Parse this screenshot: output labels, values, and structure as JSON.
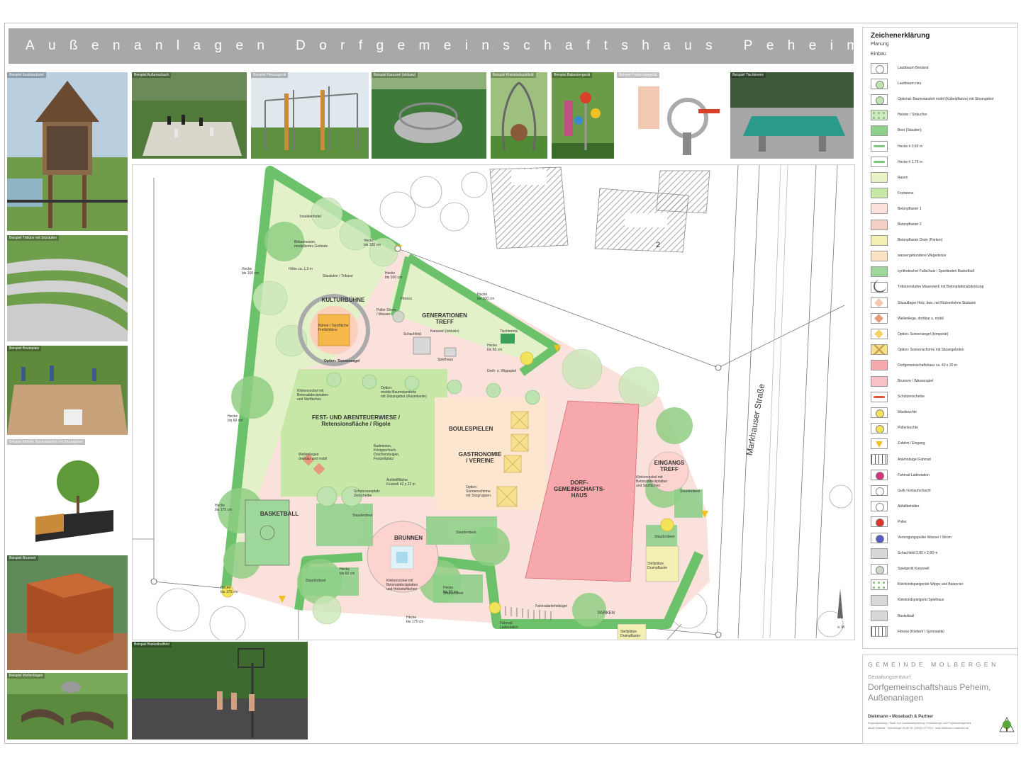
{
  "title": "Außenanlagen Dorfgemeinschaftshaus Peheim",
  "photos": {
    "insektenhotel": "Beispiel Insektenhotel",
    "aussenschach": "Beispiel Außenschach",
    "fitness": "Beispiel Fitnessgerät",
    "karussel": "Beispiel Karussel (inklusiv)",
    "kleinkind": "Beispiel Kleinkindspielfeld",
    "balancier": "Beispiel Balanciergerät",
    "federwipp": "Beispiel Federwippgerät",
    "tischtennis": "Beispiel Tischtennis",
    "tribuene": "Beispiel Tribüne mit Sitzstufen",
    "boule": "Beispiel Bouleplatz",
    "baumstandort": "Beispiel Mobiler Baumstandort mit Sitzangebot",
    "brunnen": "Beispiel Brunnen",
    "wellenliege": "Beispiel Wellenliegen",
    "basketball": "Beispiel Basketballfeld"
  },
  "plan": {
    "building_no": "2",
    "street": "Markhauser Straße",
    "areas": {
      "kulturbuehne": "KULTURBÜHNE",
      "generationen": "GENERATIONEN\nTREFF",
      "festwiese": "FEST- UND ABENTEUERWIESE /\nRetensionsfläche / Rigole",
      "boule": "BOULESPIELEN",
      "gastro": "GASTRONOMIE\n/ VEREINE",
      "dgh": "DORF-\nGEMEINSCHAFTS-\nHAUS",
      "eingang": "EINGANGS\nTREFF",
      "basketball": "BASKETBALL",
      "brunnen": "BRUNNEN",
      "parken": "PARKEN"
    },
    "labels": {
      "insektenhotel": "Insektenhotel",
      "birken": "Birkenheister,\nmodelliertes Gelände",
      "hoehe": "Höhe ca. 1,0 m",
      "sitzstufen": "Sitzstufen / Tribüne",
      "buehne": "Bühne / Tanzfläche\nFreilichtkino",
      "sonnensegel": "Option: Sonnensegel",
      "poller": "Poller Strom\n/ Wasser",
      "fitness": "Fitness",
      "karussel": "Karussel (inklusiv)",
      "schachfeld": "Schachfeld",
      "spielhaus": "Spielhaus",
      "tischtennis": "Tischtennis",
      "dreh": "Dreh- u. Wippspiel",
      "klinker1": "Klinkersockel mit\nBetonabdeckplatten\nund Sitzflächen",
      "mobile": "Option:\nmobile Baumstandorte\nmit Sitzangebot (Raumkante)",
      "wellen": "Wellenliegen\ndrehbar und mobil",
      "badminton": "Badminton,\nKönigsschach,\nDrachensteigen,\nFestzeltplatz",
      "festzelt": "Aufstellfläche\nFestzelt 42 x 22 m",
      "schirme": "Option:\nSonnenschirme\nmit Sitzgruppen",
      "schutz": "Schutzzaunplatz\nZielscheibe",
      "staudenbeet": "Staudenbeet",
      "klinker2": "Klinkersockel mit\nBetonabdeckplatten\nund Holzsitzflächen",
      "klinker3": "Klinkersockel mit\nBetonabdeckplatten\nund Sitzflächen",
      "fahrrad": "Fahrradanlehnbügel",
      "ladestation": "Fahrrad\nLadestation",
      "stellplaetze": "Stellplätze\nDrainpflaster",
      "hecke100": "Hecke\nbis 100 cm",
      "hecke60": "Hecke\nbis 60 cm",
      "hecke175": "Hecke\nbis 175 cm"
    },
    "north": "o. M"
  },
  "legend": {
    "title": "Zeichenerklärung",
    "planung": "Planung",
    "einbau": "Einbau",
    "items": [
      {
        "label": "Laubbaum Bestand",
        "fill": "#ffffff",
        "shape": "circle"
      },
      {
        "label": "Laubbaum neu",
        "fill": "#bfe3b0",
        "shape": "circle"
      },
      {
        "label": "Optional: Baumstandort mobil (Kübelpflanze) mit Sitzangebot",
        "fill": "#bfe3b0",
        "shape": "circle"
      },
      {
        "label": "Heister / Sträucher",
        "fill": "#cfe9c2",
        "shape": "dots"
      },
      {
        "label": "Beet (Stauden)",
        "fill": "#8fd18a",
        "shape": "rect"
      },
      {
        "label": "Hecke h 0,60 m",
        "fill": "#7cc57a",
        "shape": "bar"
      },
      {
        "label": "Hecke h 1,75 m",
        "fill": "#7cc57a",
        "shape": "bar"
      },
      {
        "label": "Rasen",
        "fill": "#e7f3c4",
        "shape": "rect"
      },
      {
        "label": "Festwiese",
        "fill": "#c8e8a8",
        "shape": "rect"
      },
      {
        "label": "Betonpflaster 1",
        "fill": "#fbe1dc",
        "shape": "rect"
      },
      {
        "label": "Betonpflaster 2",
        "fill": "#f6cfc4",
        "shape": "rect"
      },
      {
        "label": "Betonpflaster Drain (Parken)",
        "fill": "#f4f0b4",
        "shape": "rect"
      },
      {
        "label": "wassergebundene Wegedecke",
        "fill": "#fbe3c4",
        "shape": "rect"
      },
      {
        "label": "synthetischer Fallschutz / Sportboden Basketball",
        "fill": "#9dd79a",
        "shape": "rect"
      },
      {
        "label": "Tribünenstufen Mauerwerk mit Betonplattenabdeckung",
        "fill": "#ffffff",
        "shape": "arc"
      },
      {
        "label": "Sitzauflager Holz, bws. mit Rückenlehne Sitzbank",
        "fill": "#f2c9b0",
        "shape": "diamond"
      },
      {
        "label": "Wellenliege, drehbar u. mobil",
        "fill": "#e59a7a",
        "shape": "diamond"
      },
      {
        "label": "Option: Sonnensegel (temporär)",
        "fill": "#f6d36a",
        "shape": "diamond"
      },
      {
        "label": "Option: Sonnenschirme mit Sitzangeboten",
        "fill": "#f6e08e",
        "shape": "cross"
      },
      {
        "label": "Dorfgemeinschaftshaus ca. 40 x 20 m",
        "fill": "#f7a8ad",
        "shape": "rect"
      },
      {
        "label": "Brunnen / Wasserspiel",
        "fill": "#f8c1c6",
        "shape": "rect"
      },
      {
        "label": "Schützenscheibe",
        "fill": "#e2563a",
        "shape": "bar"
      },
      {
        "label": "Mastleuchte",
        "fill": "#f2e35a",
        "shape": "circle"
      },
      {
        "label": "Pollerleuchte",
        "fill": "#f2e35a",
        "shape": "circle"
      },
      {
        "label": "Zufahrt / Eingang",
        "fill": "#f0c020",
        "shape": "triangle"
      },
      {
        "label": "Anlehnbügel Fahrrad",
        "fill": "#ffffff",
        "shape": "lines"
      },
      {
        "label": "Fahrrad Ladestation",
        "fill": "#d8327a",
        "shape": "circle"
      },
      {
        "label": "Gulli / Einlaufschacht",
        "fill": "#ffffff",
        "shape": "circle"
      },
      {
        "label": "Abfallbehälter",
        "fill": "#ffffff",
        "shape": "circle"
      },
      {
        "label": "Poller",
        "fill": "#e0302a",
        "shape": "circle"
      },
      {
        "label": "Versorgungspoller Wasser / Strom",
        "fill": "#5a5ac8",
        "shape": "circle"
      },
      {
        "label": "Schachfeld 2,80 x 2,80 m",
        "fill": "#d8d8d8",
        "shape": "rect"
      },
      {
        "label": "Spielgerät Karussell",
        "fill": "#cfd8c8",
        "shape": "circle"
      },
      {
        "label": "Kleinkindspielgeräte Wippe und Balancier",
        "fill": "#ffffff",
        "shape": "dots"
      },
      {
        "label": "Kleinkindspielgerät Spielhaus",
        "fill": "#d8d8d8",
        "shape": "rect"
      },
      {
        "label": "Basketball",
        "fill": "#d8d8d8",
        "shape": "rect"
      },
      {
        "label": "Fitness (Klettern / Gymnastik)",
        "fill": "#ffffff",
        "shape": "lines"
      }
    ]
  },
  "titleblock": {
    "gemeinde": "GEMEINDE MOLBERGEN",
    "entwurf": "Gestaltungsentwurf",
    "project": "Dorfgemeinschaftshaus Peheim,\nAußenanlagen",
    "firm": "Diekmann • Mosebach & Partner",
    "line1": "Regionalplanung • Stadt- und Landschaftsplanung • Entwicklungs- und Projektmanagement",
    "line2": "26180 Rastede · Oldenburger Str.86 Tel. (04402) 97793-0 · www.diekmann-mosebach.de"
  },
  "colors": {
    "hedge": "#6cc26a",
    "paving": "#fbe1dc",
    "lawn": "#e3f1c9",
    "dgh": "#f7a8ad",
    "title_bar": "#a8a8a8"
  }
}
